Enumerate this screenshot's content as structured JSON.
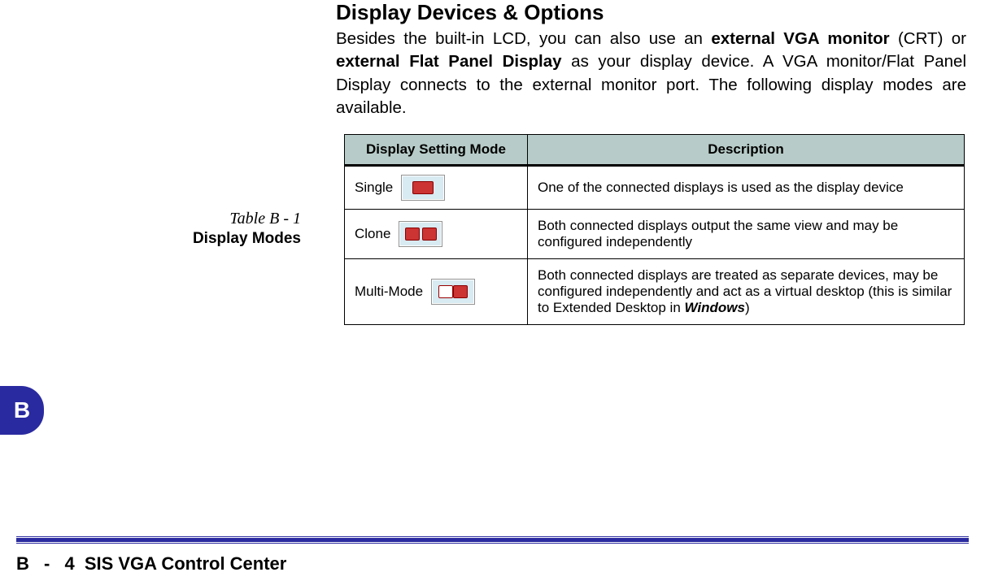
{
  "heading": "Display Devices & Options",
  "intro": {
    "pre": "Besides the built-in LCD, you can also use an ",
    "bold1": "external VGA monitor",
    "mid1": " (CRT) or ",
    "bold2": "external Flat Panel Display",
    "post": " as your display device. A VGA monitor/Flat Panel Display connects to the external monitor port. The following display modes are available."
  },
  "table_label": {
    "number": "Table B - 1",
    "title": "Display Modes"
  },
  "table": {
    "headers": [
      "Display Setting Mode",
      "Description"
    ],
    "rows": [
      {
        "mode": "Single",
        "icon": "single",
        "desc": "One of the connected displays is used as the display device"
      },
      {
        "mode": "Clone",
        "icon": "clone",
        "desc": "Both connected displays output the same view and may be configured independently"
      },
      {
        "mode": "Multi-Mode",
        "icon": "multi",
        "desc_pre": "Both connected displays are treated as separate devices, may be configured independently and act as a virtual desktop (this is similar to Extended Desktop in ",
        "desc_bold": "Windows",
        "desc_post": ")"
      }
    ]
  },
  "chapter_tab": "B",
  "footer": {
    "page_label": "B - 4",
    "title": "SIS VGA Control Center"
  }
}
